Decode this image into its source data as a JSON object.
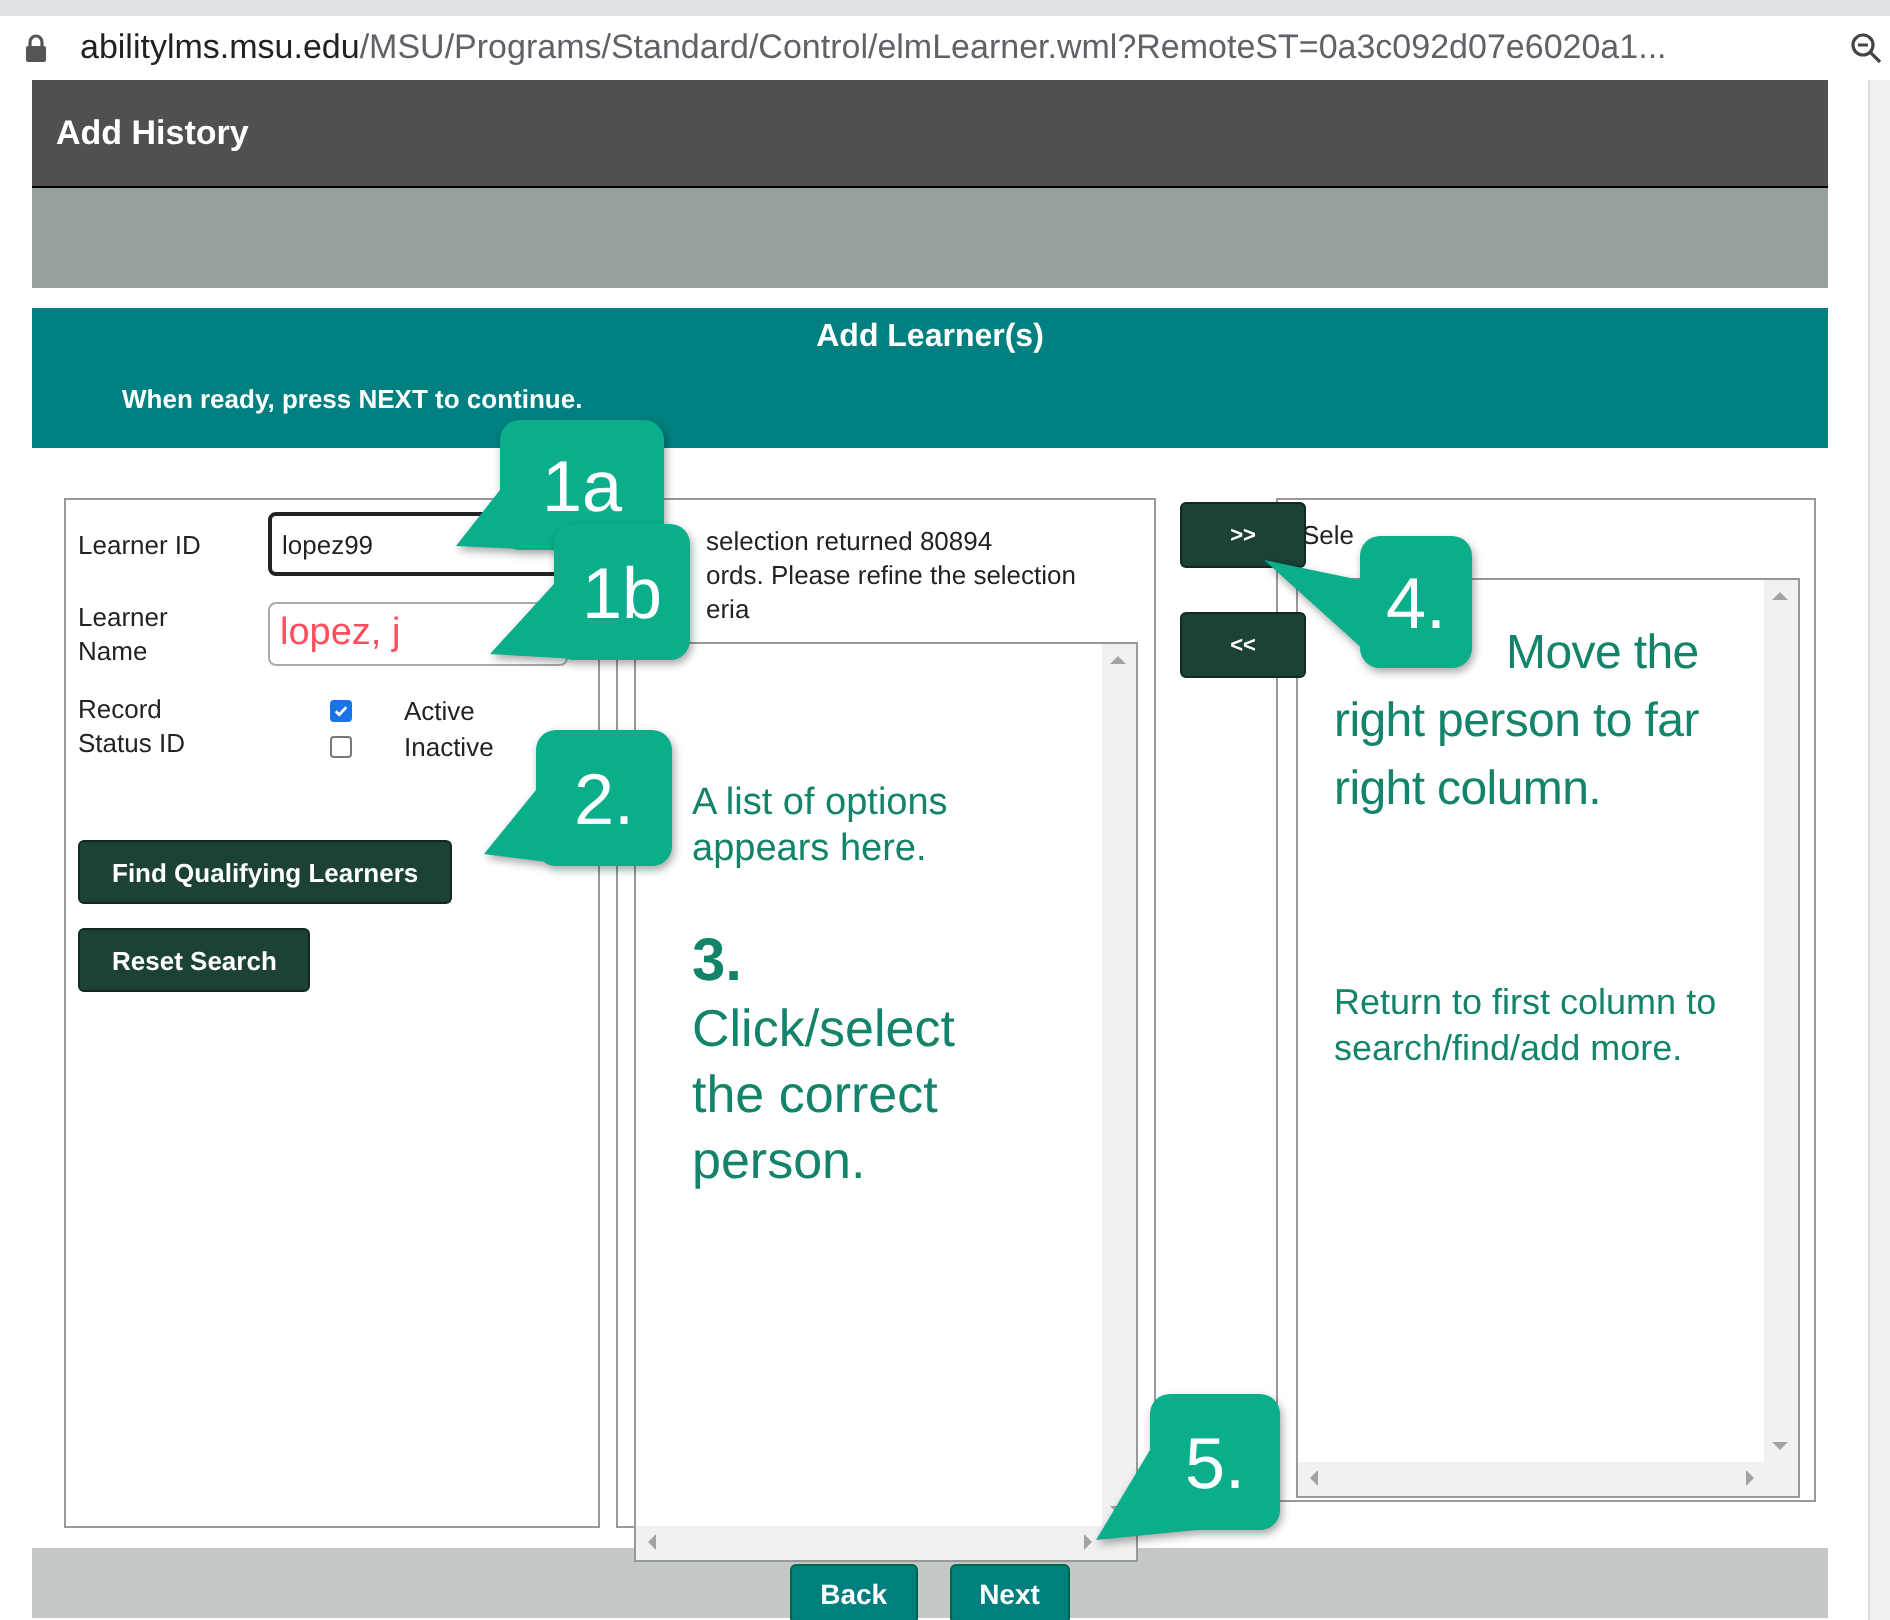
{
  "browser": {
    "url_host": "abilitylms.msu.edu",
    "url_path": "/MSU/Programs/Standard/Control/elmLearner.wml?RemoteST=0a3c092d07e6020a1..."
  },
  "page_title": "Add History",
  "section": {
    "title": "Add Learner(s)",
    "instruction": "When ready, press **NEXT** to continue."
  },
  "search": {
    "fields": [
      {
        "label": "Learner ID",
        "value": "lopez99",
        "focused": true
      },
      {
        "label": "Learner Name",
        "value": "lopez, j",
        "focused": false
      }
    ],
    "status_label": "Record Status ID",
    "status_options": [
      {
        "label": "Active",
        "checked": true
      },
      {
        "label": "Inactive",
        "checked": false
      }
    ],
    "buttons": [
      "Find Qualifying Learners",
      "Reset Search"
    ]
  },
  "results": {
    "message_lines": [
      "selection returned 80894",
      "ords. Please refine the selection",
      "eria"
    ],
    "notes": [
      {
        "kind": "text",
        "text": "A list of options appears here."
      },
      {
        "kind": "step",
        "text": "3."
      },
      {
        "kind": "big",
        "text": "Click/select the correct person."
      }
    ]
  },
  "move_buttons": [
    ">>",
    "<<"
  ],
  "selected": {
    "label": "Sele",
    "notes": [
      {
        "kind": "lead",
        "text": "Move the right person to far right column."
      },
      {
        "kind": "text",
        "text": "Return to first column to search/find/add more."
      }
    ]
  },
  "nav_buttons": [
    "Back",
    "Next"
  ],
  "callouts": [
    {
      "label": "1a"
    },
    {
      "label": "1b"
    },
    {
      "label": "2."
    },
    {
      "label": "4."
    },
    {
      "label": "5."
    }
  ]
}
